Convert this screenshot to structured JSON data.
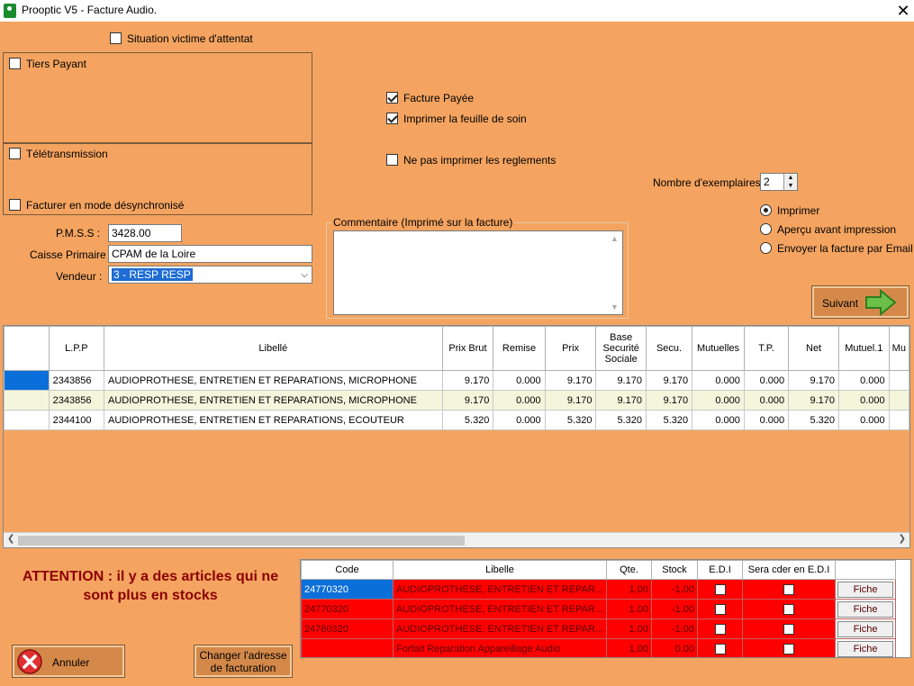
{
  "window": {
    "title": "Prooptic V5 - Facture Audio.",
    "close": "✕"
  },
  "options": {
    "victime_attentat": {
      "label": "Situation victime d'attentat",
      "checked": false
    },
    "tiers_payant": {
      "label": "Tiers Payant",
      "checked": false
    },
    "teletransmission": {
      "label": "Télétransmission",
      "checked": false
    },
    "desynchro": {
      "label": "Facturer en mode désynchronisé",
      "checked": false
    },
    "facture_payee": {
      "label": "Facture Payée",
      "checked": true
    },
    "imprimer_feuille": {
      "label": "Imprimer la feuille de soin",
      "checked": true
    },
    "ne_pas_imprimer": {
      "label": "Ne pas imprimer les reglements",
      "checked": false
    }
  },
  "fields": {
    "pmss_label": "P.M.S.S :",
    "pmss_value": "3428.00",
    "caisse_label": "Caisse Primaire :",
    "caisse_value": "CPAM de la Loire",
    "vendeur_label": "Vendeur :",
    "vendeur_value": "3 - RESP RESP",
    "commentaire_label": "Commentaire (Imprimé sur la facture)",
    "commentaire_value": "",
    "exemplaires_label": "Nombre d'exemplaires :",
    "exemplaires_value": "2"
  },
  "print_mode": {
    "options": [
      {
        "label": "Imprimer",
        "selected": true
      },
      {
        "label": "Aperçu avant impression",
        "selected": false
      },
      {
        "label": "Envoyer la facture par Email",
        "selected": false
      }
    ]
  },
  "buttons": {
    "suivant": "Suivant",
    "annuler": "Annuler",
    "changer_adresse_l1": "Changer l'adresse",
    "changer_adresse_l2": "de facturation"
  },
  "lines_table": {
    "headers": [
      "L.P.P",
      "Libellé",
      "Prix Brut",
      "Remise",
      "Prix",
      "Base Securité Sociale",
      "Secu.",
      "Mutuelles",
      "T.P.",
      "Net",
      "Mutuel.1",
      "Mu"
    ],
    "rows": [
      [
        "2343856",
        "AUDIOPROTHESE, ENTRETIEN ET REPARATIONS, MICROPHONE",
        "9.170",
        "0.000",
        "9.170",
        "9.170",
        "9.170",
        "0.000",
        "0.000",
        "9.170",
        "0.000"
      ],
      [
        "2343856",
        "AUDIOPROTHESE, ENTRETIEN ET REPARATIONS, MICROPHONE",
        "9.170",
        "0.000",
        "9.170",
        "9.170",
        "9.170",
        "0.000",
        "0.000",
        "9.170",
        "0.000"
      ],
      [
        "2344100",
        "AUDIOPROTHESE, ENTRETIEN ET REPARATIONS, ECOUTEUR",
        "5.320",
        "0.000",
        "5.320",
        "5.320",
        "5.320",
        "0.000",
        "0.000",
        "5.320",
        "0.000"
      ]
    ]
  },
  "warning": {
    "line1": "ATTENTION : il y a des articles qui ne",
    "line2": "sont plus en stocks"
  },
  "stock_table": {
    "headers": [
      "Code",
      "Libelle",
      "Qte.",
      "Stock",
      "E.D.I",
      "Sera cder en E.D.I",
      ""
    ],
    "fiche_label": "Fiche",
    "rows": [
      [
        "24770320",
        "AUDIOPROTHESE, ENTRETIEN ET REPAR...",
        "1.00",
        "-1.00"
      ],
      [
        "24770320",
        "AUDIOPROTHESE, ENTRETIEN ET REPAR...",
        "1.00",
        "-1.00"
      ],
      [
        "24760320",
        "AUDIOPROTHESE, ENTRETIEN ET REPAR...",
        "1.00",
        "-1.00"
      ],
      [
        "",
        "Forfait Reparation Appareillage Audio",
        "1.00",
        "0.00"
      ]
    ]
  },
  "colors": {
    "background": "#F4A460",
    "warning": "#8B0000",
    "out_of_stock": "#FF0000",
    "selection": "#0A6FD8"
  }
}
